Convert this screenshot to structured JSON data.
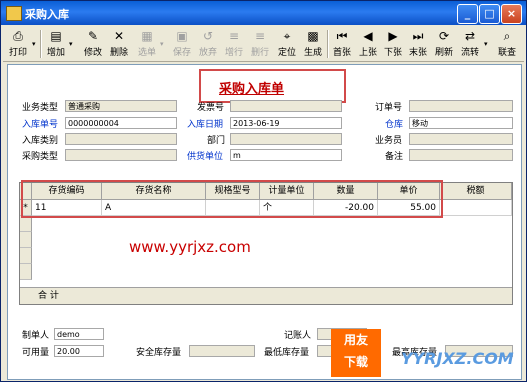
{
  "window": {
    "title": "采购入库",
    "min": "_",
    "max": "□",
    "close": "×"
  },
  "toolbar": [
    {
      "label": "打印",
      "icon": "printer-icon",
      "glyph": "⎙",
      "enabled": true
    },
    {
      "label": "增加",
      "icon": "add-icon",
      "glyph": "▤",
      "enabled": true
    },
    {
      "label": "修改",
      "icon": "edit-icon",
      "glyph": "✎",
      "enabled": true
    },
    {
      "label": "删除",
      "icon": "delete-icon",
      "glyph": "✕",
      "enabled": true
    },
    {
      "label": "选单",
      "icon": "select-icon",
      "glyph": "▦",
      "enabled": false
    },
    {
      "label": "保存",
      "icon": "save-icon",
      "glyph": "▣",
      "enabled": false
    },
    {
      "label": "放弃",
      "icon": "discard-icon",
      "glyph": "↺",
      "enabled": false
    },
    {
      "label": "增行",
      "icon": "add-row-icon",
      "glyph": "≡",
      "enabled": false
    },
    {
      "label": "删行",
      "icon": "delete-row-icon",
      "glyph": "≡",
      "enabled": false
    },
    {
      "label": "定位",
      "icon": "locate-icon",
      "glyph": "⌖",
      "enabled": true
    },
    {
      "label": "生成",
      "icon": "generate-icon",
      "glyph": "▩",
      "enabled": true
    },
    {
      "label": "首张",
      "icon": "first-icon",
      "glyph": "⏮",
      "enabled": true
    },
    {
      "label": "上张",
      "icon": "prev-icon",
      "glyph": "◀",
      "enabled": true
    },
    {
      "label": "下张",
      "icon": "next-icon",
      "glyph": "▶",
      "enabled": true
    },
    {
      "label": "末张",
      "icon": "last-icon",
      "glyph": "⏭",
      "enabled": true
    },
    {
      "label": "刷新",
      "icon": "refresh-icon",
      "glyph": "⟳",
      "enabled": true
    },
    {
      "label": "流转",
      "icon": "flow-icon",
      "glyph": "⇄",
      "enabled": true
    },
    {
      "label": "联查",
      "icon": "query-icon",
      "glyph": "⌕",
      "enabled": true
    }
  ],
  "form": {
    "heading": "采购入库单",
    "fields": {
      "business_type": {
        "label": "业务类型",
        "value": "普通采购"
      },
      "receipt_no": {
        "label": "入库单号",
        "value": "0000000004"
      },
      "receipt_category": {
        "label": "入库类别",
        "value": ""
      },
      "purchase_type": {
        "label": "采购类型",
        "value": ""
      },
      "invoice_no": {
        "label": "发票号",
        "value": ""
      },
      "receipt_date": {
        "label": "入库日期",
        "value": "2013-06-19"
      },
      "department": {
        "label": "部门",
        "value": ""
      },
      "supplier": {
        "label": "供货单位",
        "value": "m"
      },
      "order_no": {
        "label": "订单号",
        "value": ""
      },
      "warehouse": {
        "label": "仓库",
        "value": "移动"
      },
      "salesperson": {
        "label": "业务员",
        "value": ""
      },
      "remarks": {
        "label": "备注",
        "value": ""
      }
    }
  },
  "grid": {
    "columns": [
      "存货编码",
      "存货名称",
      "规格型号",
      "计量单位",
      "数量",
      "单价",
      "税额"
    ],
    "rows": [
      {
        "marker": "*",
        "cells": [
          "11",
          "A",
          "",
          "个",
          "-20.00",
          "55.00",
          ""
        ]
      }
    ],
    "total_label": "合  计"
  },
  "footer": {
    "creator": {
      "label": "制单人",
      "value": "demo"
    },
    "available": {
      "label": "可用量",
      "value": "20.00"
    },
    "safety_stock": {
      "label": "安全库存量",
      "value": ""
    },
    "min_stock": {
      "label": "最低库存量",
      "value": ""
    },
    "max_stock": {
      "label": "最高库存量",
      "value": ""
    },
    "bookkeeper": {
      "label": "记账人",
      "value": ""
    }
  },
  "watermark": "www.yyrjxz.com",
  "logo_text": [
    "用友",
    "下载"
  ],
  "logo2": "YYRJXZ.COM"
}
